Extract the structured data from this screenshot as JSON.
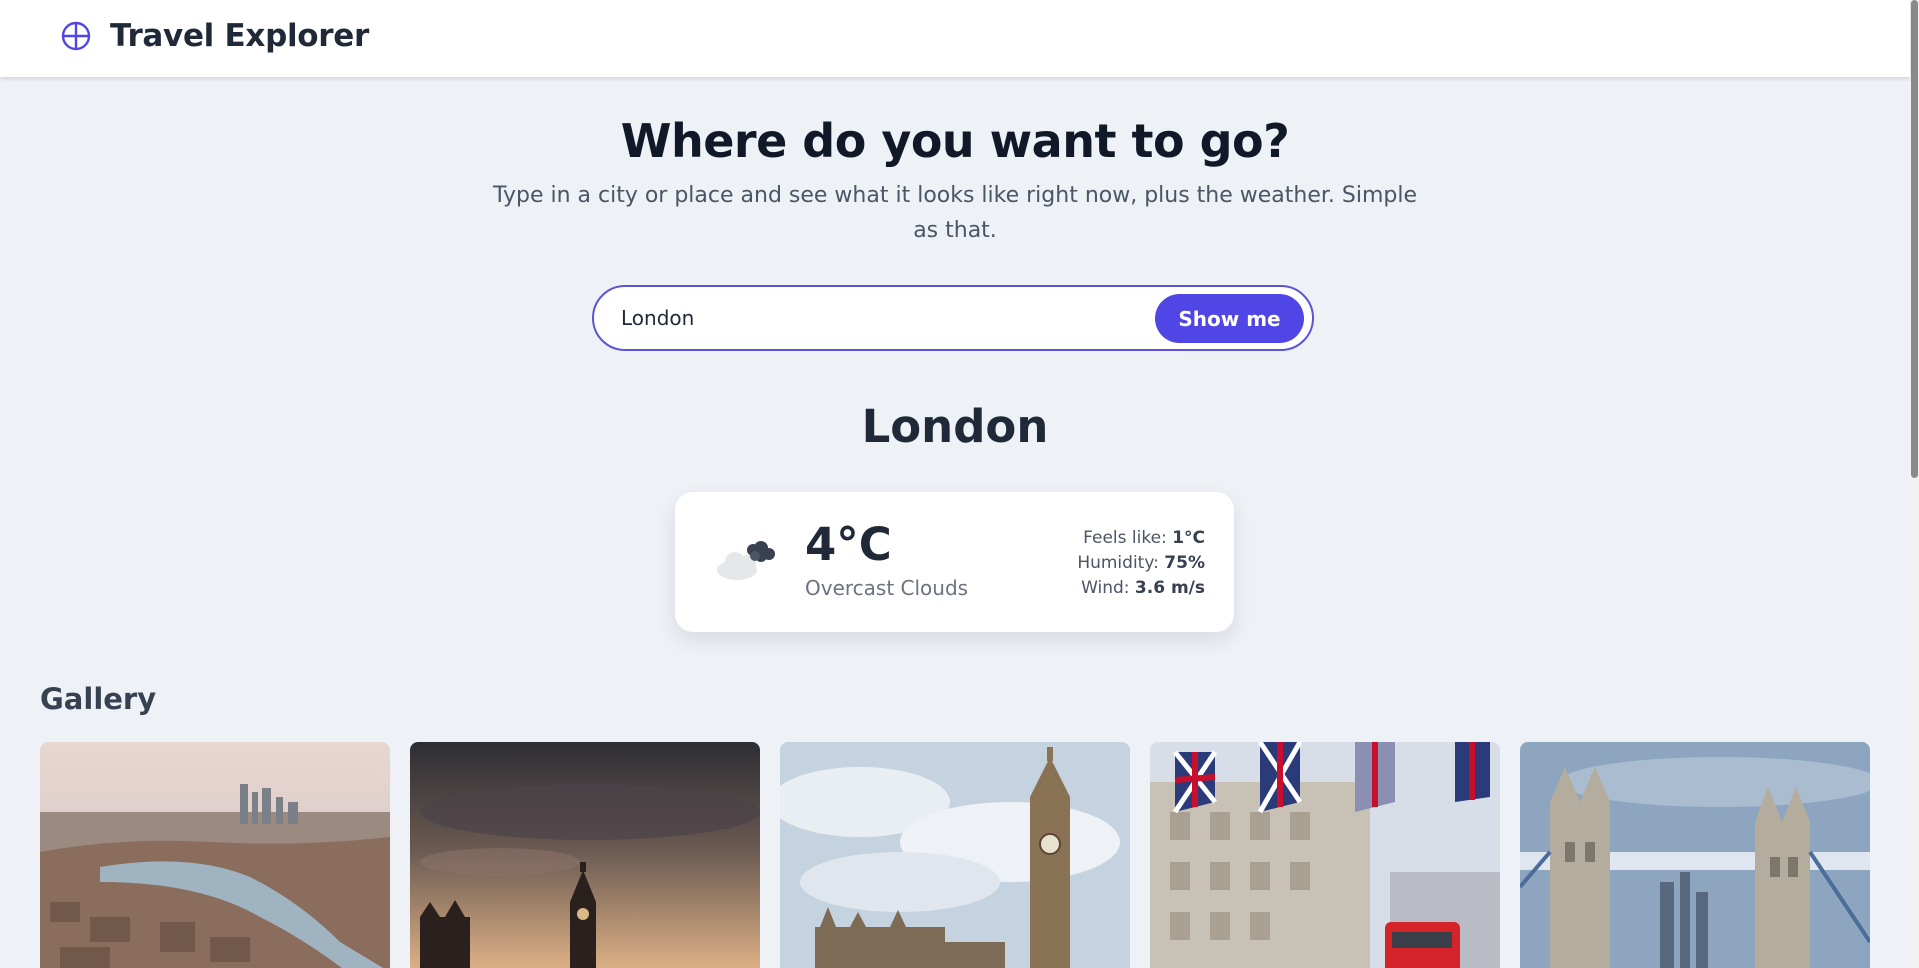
{
  "header": {
    "title": "Travel Explorer",
    "logo_icon": "globe-crosshair-icon",
    "brand_color": "#4f46e5"
  },
  "hero": {
    "title": "Where do you want to go?",
    "subtitle": "Type in a city or place and see what it looks like right now, plus the weather. Simple as that."
  },
  "search": {
    "value": "London",
    "placeholder": "",
    "button_label": "Show me"
  },
  "result": {
    "city": "London"
  },
  "weather": {
    "icon": "overcast-clouds-icon",
    "temperature": "4°C",
    "description": "Overcast Clouds",
    "feels_like_label": "Feels like:",
    "feels_like_value": "1°C",
    "humidity_label": "Humidity:",
    "humidity_value": "75%",
    "wind_label": "Wind:",
    "wind_value": "3.6 m/s"
  },
  "gallery": {
    "title": "Gallery",
    "photos": [
      {
        "name": "london-aerial-thames-photo"
      },
      {
        "name": "big-ben-sunset-photo"
      },
      {
        "name": "big-ben-parliament-photo"
      },
      {
        "name": "union-jack-street-bus-photo"
      },
      {
        "name": "tower-bridge-photo"
      }
    ]
  }
}
